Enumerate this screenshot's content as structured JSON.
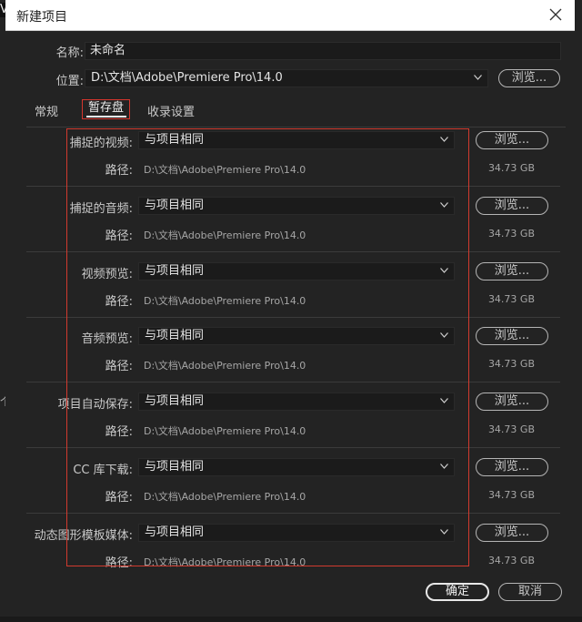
{
  "window": {
    "title": "新建项目"
  },
  "form": {
    "name_label": "名称:",
    "name_value": "未命名",
    "location_label": "位置:",
    "location_value": "D:\\文档\\Adobe\\Premiere Pro\\14.0",
    "browse_label": "浏览..."
  },
  "tabs": [
    {
      "label": "常规",
      "active": false
    },
    {
      "label": "暂存盘",
      "active": true
    },
    {
      "label": "收录设置",
      "active": false
    }
  ],
  "scratch_rows": [
    {
      "label": "捕捉的视频:",
      "select": "与项目相同",
      "path_label": "路径:",
      "path": "D:\\文档\\Adobe\\Premiere Pro\\14.0",
      "size": "34.73 GB",
      "browse": "浏览..."
    },
    {
      "label": "捕捉的音频:",
      "select": "与项目相同",
      "path_label": "路径:",
      "path": "D:\\文档\\Adobe\\Premiere Pro\\14.0",
      "size": "34.73 GB",
      "browse": "浏览..."
    },
    {
      "label": "视频预览:",
      "select": "与项目相同",
      "path_label": "路径:",
      "path": "D:\\文档\\Adobe\\Premiere Pro\\14.0",
      "size": "34.73 GB",
      "browse": "浏览..."
    },
    {
      "label": "音频预览:",
      "select": "与项目相同",
      "path_label": "路径:",
      "path": "D:\\文档\\Adobe\\Premiere Pro\\14.0",
      "size": "34.73 GB",
      "browse": "浏览..."
    },
    {
      "label": "项目自动保存:",
      "select": "与项目相同",
      "path_label": "路径:",
      "path": "D:\\文档\\Adobe\\Premiere Pro\\14.0",
      "size": "34.73 GB",
      "browse": "浏览..."
    },
    {
      "label": "CC 库下载:",
      "select": "与项目相同",
      "path_label": "路径:",
      "path": "D:\\文档\\Adobe\\Premiere Pro\\14.0",
      "size": "34.73 GB",
      "browse": "浏览..."
    },
    {
      "label": "动态图形模板媒体:",
      "select": "与项目相同",
      "path_label": "路径:",
      "path": "D:\\文档\\Adobe\\Premiere Pro\\14.0",
      "size": "34.73 GB",
      "browse": "浏览..."
    }
  ],
  "buttons": {
    "ok": "确定",
    "cancel": "取消"
  },
  "edge": {
    "left_top": "V",
    "left_mid": "个"
  },
  "colors": {
    "highlight": "#d13a2e",
    "background": "#232323"
  },
  "icons": {
    "close": "close-icon",
    "dropdown": "chevron-down-icon"
  }
}
